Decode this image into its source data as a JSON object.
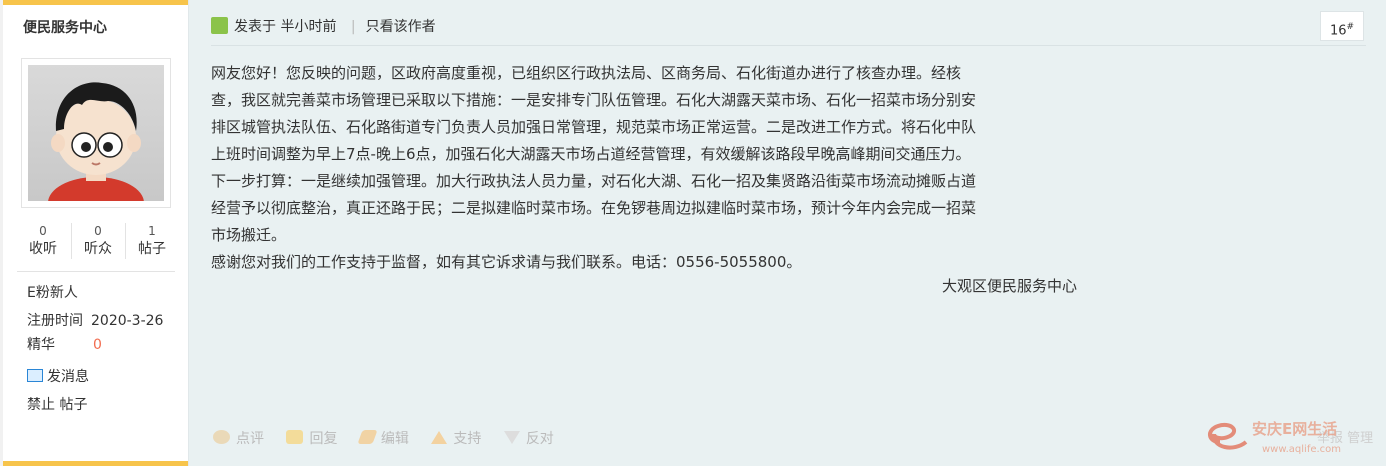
{
  "user": {
    "name": "便民服务中心",
    "stats": [
      {
        "num": "0",
        "label": "收听"
      },
      {
        "num": "0",
        "label": "听众"
      },
      {
        "num": "1",
        "label": "帖子"
      }
    ],
    "rank": "E粉新人",
    "reg_label": "注册时间",
    "reg_date": "2020-3-26",
    "elite_label": "精华",
    "elite_value": "0",
    "send_msg": "发消息",
    "ban_label": "禁止 帖子"
  },
  "post": {
    "posted_prefix": "发表于",
    "posted_time": "半小时前",
    "only_author": "只看该作者",
    "floor": "16",
    "floor_mark": "#",
    "content_lines": [
      "网友您好！您反映的问题，区政府高度重视，已组织区行政执法局、区商务局、石化街道办进行了核查办理。经核",
      "查，我区就完善菜市场管理已采取以下措施：一是安排专门队伍管理。石化大湖露天菜市场、石化一招菜市场分别安",
      "排区城管执法队伍、石化路街道专门负责人员加强日常管理，规范菜市场正常运营。二是改进工作方式。将石化中队",
      "上班时间调整为早上7点-晚上6点，加强石化大湖露天市场占道经营管理，有效缓解该路段早晚高峰期间交通压力。",
      "下一步打算：一是继续加强管理。加大行政执法人员力量，对石化大湖、石化一招及集贤路沿街菜市场流动摊贩占道",
      "经营予以彻底整治，真正还路于民；二是拟建临时菜市场。在免锣巷周边拟建临时菜市场，预计今年内会完成一招菜",
      "市场搬迁。",
      "感谢您对我们的工作支持于监督，如有其它诉求请与我们联系。电话：0556-5055800。"
    ],
    "signature": "大观区便民服务中心"
  },
  "actions": {
    "comment": "点评",
    "reply": "回复",
    "edit": "编辑",
    "support": "支持",
    "oppose": "反对"
  },
  "faint_right": "举报  管理",
  "watermark": {
    "text": "安庆E网生活",
    "url": "www.aqlife.com"
  }
}
